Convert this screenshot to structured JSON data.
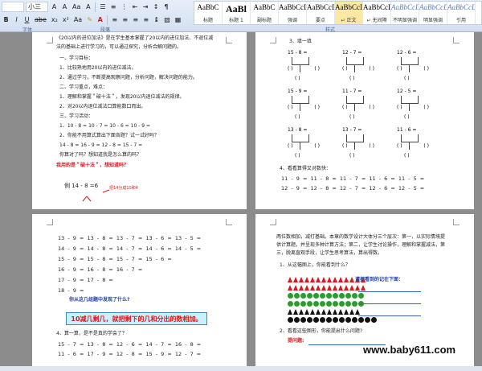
{
  "ribbon": {
    "font_name": "",
    "font_size": "小三",
    "row1_glyphs": [
      "A",
      "A",
      "Aa",
      "A"
    ],
    "row1_icons": [
      "bullets-icon",
      "numbering-icon",
      "outline-icon",
      "decrease-indent-icon",
      "increase-indent-icon",
      "sort-icon",
      "show-marks-icon"
    ],
    "row2_labels": [
      "I",
      "U",
      "abe",
      "x₂",
      "x²",
      "Aa"
    ],
    "groups": {
      "font": "字体",
      "paragraph": "段落",
      "styles": "样式"
    },
    "styles": [
      {
        "preview": "AaBbC",
        "label": "标题"
      },
      {
        "preview": "AaBl",
        "label": "标题 1"
      },
      {
        "preview": "AaBbC",
        "label": "副标题"
      },
      {
        "preview": "AaBbCcDı",
        "label": "强调"
      },
      {
        "preview": "AaBbCcD",
        "label": "要点"
      },
      {
        "preview": "AaBbCcD",
        "label": "↵ 正文"
      },
      {
        "preview": "AaBbCcD",
        "label": "↵ 无间隔"
      },
      {
        "preview": "AaBbCcDı",
        "label": "不明显强调"
      },
      {
        "preview": "AaBbCcDı",
        "label": "明显强调"
      },
      {
        "preview": "AaBbCcDı",
        "label": "引用"
      }
    ]
  },
  "page1": {
    "lines": [
      "《20以内的进位加法》是在学生基本掌握了20以内的进位加法、不退位减",
      "法的基础上进行学习的，可以通过探究，分析合解问题的。",
      "一、学习目标：",
      "1、比较熟地用20以内的进位减法。",
      "2、通过学习，不断提高观察问题，分析问题，解决问题的能力。",
      "二、学习重点，难点：",
      "1、理解和掌握＂破十法＂，发现20以内退位减法的规律。",
      "2、对20以内退位减法口算能数口而出。",
      "三、学习活动：",
      "1、10 - 8 =        10 - 7 =        10 - 6 =        10 - 9 =",
      "2、你能不用算式算出下面各题？试一试好吗？",
      "    14 - 8 =        16 - 9 =        12 - 8 =        15 - 7 =",
      "    你算对了吗？想知道我是怎么算的吗？"
    ],
    "red_heading": "我用的是＂破十法＂，想知道吗？",
    "red_note": "把14分成10和4",
    "example": "例 14 - 8 =6"
  },
  "page2": {
    "section3": "3、填一填",
    "trees": [
      "15 - 8 =",
      "12 - 7 =",
      "12 - 6 =",
      "15 - 9 =",
      "11 - 7 =",
      "12 - 5 =",
      "13 - 8 =",
      "13 - 7 =",
      "11 - 6 ="
    ],
    "paren": "(  )",
    "section4": "4、看看算得又对数快：",
    "row1": "11 - 9 =    11 - 8 =    11 - 7 =    11 - 6 =    11 - 5 =",
    "row2": "12 - 9 =    12 - 8 =    12 - 7 =    12 - 6 =    12 - 5 ="
  },
  "page3": {
    "rows": [
      "13 - 9 =      13 - 8 =      13 - 7 =      13 - 6 =      13 - 5 =",
      "14 - 9 =      14 - 8 =      14 - 7 =      14 - 6 =      14 - 5 =",
      "15 - 9 =      15 - 8 =      15 - 7 =      15 - 6 =",
      "16 - 9 =      16 - 8 =      16 - 7 =",
      "17 - 9 =      17 - 8 =",
      "18 - 9 ="
    ],
    "question": "你从这几组题中发现了什么?",
    "banner": "10减几剩几，就把剩下的几和分出的数相加。",
    "section4": "4、算一算，是不是真的学会了？",
    "rows2": [
      "15 - 7 =      13 - 8 =      12 - 6 =      14 - 7 =      16 - 8 =",
      "11 - 6 =      17 - 9 =      12 - 8 =      15 - 9 =      12 - 7 ="
    ]
  },
  "page4": {
    "para1": "两位数相加，减打基础。本章的数学设计大体分三个层次：第一，以实际情境提",
    "para2": "供计算题，并呈现多种计算方法；第二，让学生讨论操作，理解和掌握减法，第",
    "para3": "三，脱离直观手段，让学生思考算法，算出得数。",
    "q1": "1、从这幅图上，你能看到什么？",
    "q1_blue": "请把看到的记在下面：",
    "q2": "2、看看这些图形，你能提出什么问题?",
    "q2_red": "提问题:",
    "shape_colors": {
      "red": "#d71a1a",
      "green": "#2d9b2d",
      "black": "#111111"
    }
  },
  "watermark": "www.baby611.com"
}
